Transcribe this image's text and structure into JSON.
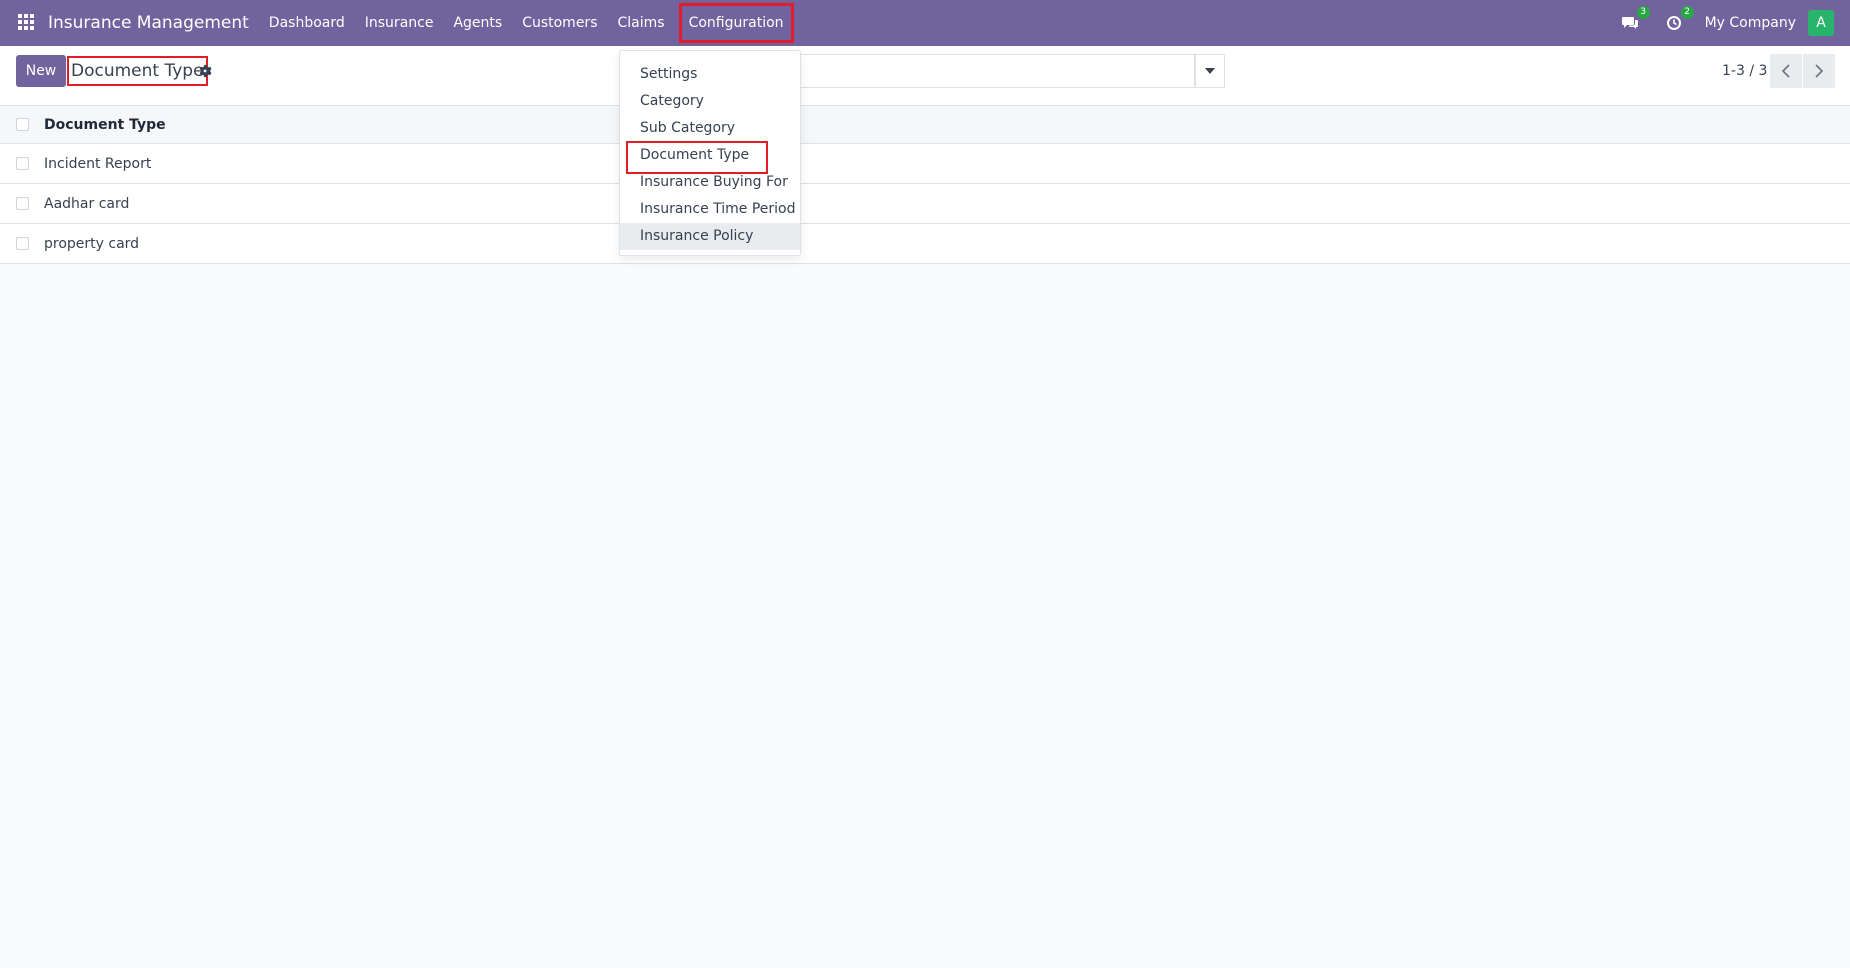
{
  "navbar": {
    "brand": "Insurance Management",
    "menu": [
      "Dashboard",
      "Insurance",
      "Agents",
      "Customers",
      "Claims",
      "Configuration"
    ],
    "messages_count": "3",
    "activities_count": "2",
    "company": "My Company",
    "avatar_letter": "A",
    "bg_color": "#71639e"
  },
  "control_panel": {
    "new_label": "New",
    "breadcrumb": "Document Type",
    "search_placeholder": "",
    "pager": "1-3 / 3"
  },
  "list": {
    "column": "Document Type",
    "rows": [
      "Incident Report",
      "Aadhar card",
      "property card"
    ]
  },
  "dropdown": {
    "items": [
      "Settings",
      "Category",
      "Sub Category",
      "Document Type",
      "Insurance Buying For",
      "Insurance Time Period",
      "Insurance Policy"
    ]
  },
  "icons": [
    "apps-grid-icon",
    "chat-icon",
    "clock-icon",
    "gear-icon",
    "caret-down-icon",
    "chevron-left-icon",
    "chevron-right-icon"
  ]
}
